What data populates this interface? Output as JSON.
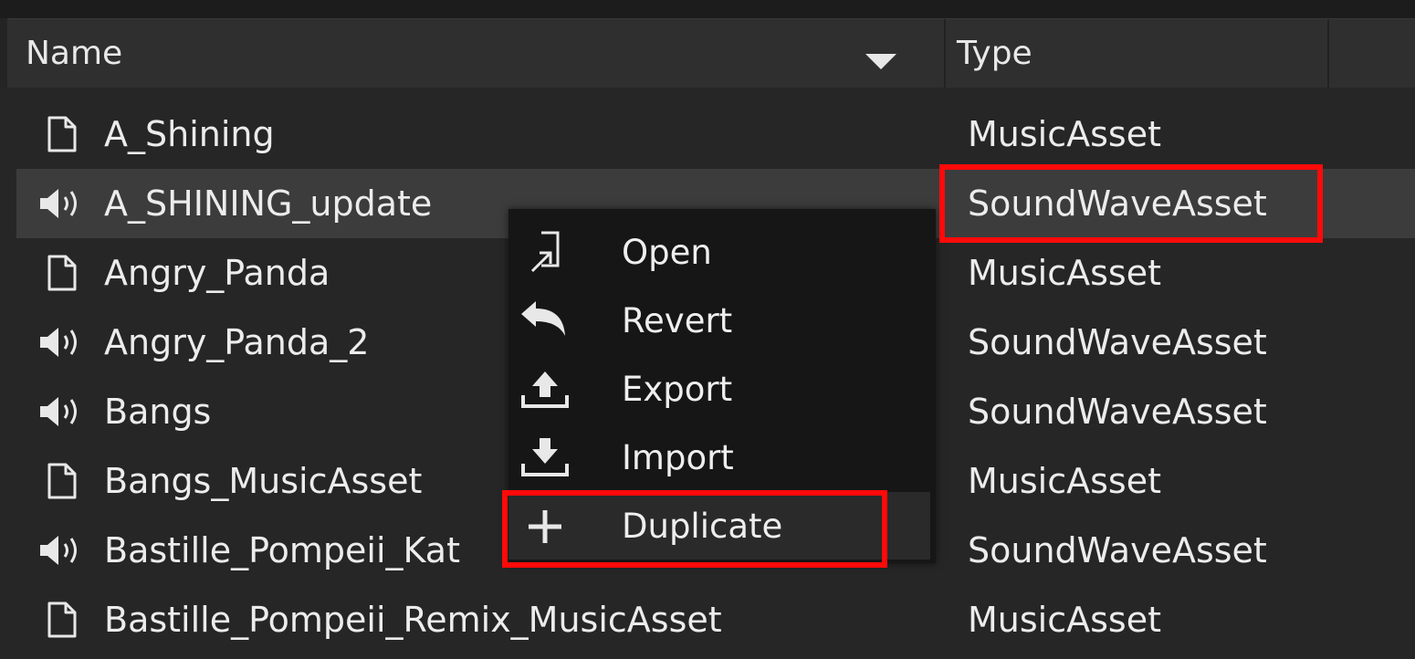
{
  "columns": {
    "name": "Name",
    "type": "Type"
  },
  "rows": [
    {
      "name": "A_Shining",
      "type": "MusicAsset",
      "icon": "document-icon",
      "selected": false
    },
    {
      "name": "A_SHINING_update",
      "type": "SoundWaveAsset",
      "icon": "speaker-icon",
      "selected": true
    },
    {
      "name": "Angry_Panda",
      "type": "MusicAsset",
      "icon": "document-icon",
      "selected": false
    },
    {
      "name": "Angry_Panda_2",
      "type": "SoundWaveAsset",
      "icon": "speaker-icon",
      "selected": false
    },
    {
      "name": "Bangs",
      "type": "SoundWaveAsset",
      "icon": "speaker-icon",
      "selected": false
    },
    {
      "name": "Bangs_MusicAsset",
      "type": "MusicAsset",
      "icon": "document-icon",
      "selected": false
    },
    {
      "name": "Bastille_Pompeii_Kat",
      "type": "SoundWaveAsset",
      "icon": "speaker-icon",
      "selected": false
    },
    {
      "name": "Bastille_Pompeii_Remix_MusicAsset",
      "type": "MusicAsset",
      "icon": "document-icon",
      "selected": false
    }
  ],
  "context_menu": {
    "items": [
      {
        "label": "Open",
        "icon": "open-icon"
      },
      {
        "label": "Revert",
        "icon": "revert-icon"
      },
      {
        "label": "Export",
        "icon": "export-icon"
      },
      {
        "label": "Import",
        "icon": "import-icon"
      },
      {
        "label": "Duplicate",
        "icon": "plus-icon"
      }
    ]
  },
  "colors": {
    "highlight": "#ff0a0a",
    "background": "#242424",
    "selected_row": "#3c3c3c",
    "menu_background": "#161616"
  }
}
